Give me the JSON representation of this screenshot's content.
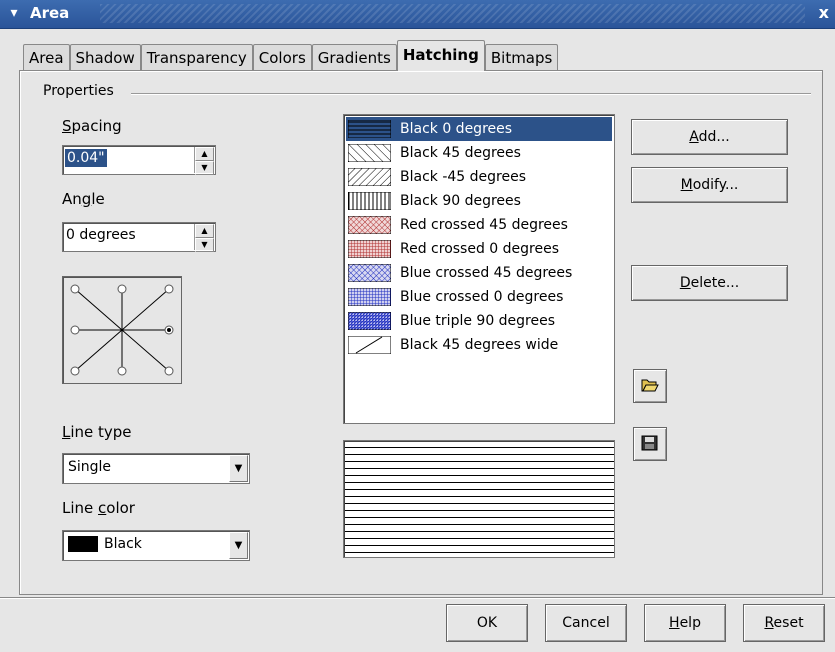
{
  "window": {
    "title": "Area",
    "close_glyph": "x"
  },
  "tabs": [
    {
      "label": "Area",
      "active": false
    },
    {
      "label": "Shadow",
      "active": false
    },
    {
      "label": "Transparency",
      "active": false
    },
    {
      "label": "Colors",
      "active": false
    },
    {
      "label": "Gradients",
      "active": false
    },
    {
      "label": "Hatching",
      "active": true
    },
    {
      "label": "Bitmaps",
      "active": false
    }
  ],
  "properties": {
    "group_label": "Properties",
    "spacing": {
      "label_u": "S",
      "label_rest": "pacing",
      "value": "0.04\""
    },
    "angle": {
      "label_pre": "An",
      "label_u": "g",
      "label_rest": "le",
      "value": "0 degrees"
    },
    "line_type": {
      "label_pre": "",
      "label_u": "L",
      "label_rest": "ine type",
      "value": "Single"
    },
    "line_color": {
      "label_pre": "Line ",
      "label_u": "c",
      "label_rest": "olor",
      "value": "Black",
      "swatch_color": "#000000"
    }
  },
  "hatch_list": [
    {
      "label": "Black 0 degrees",
      "selected": true
    },
    {
      "label": "Black 45 degrees",
      "selected": false
    },
    {
      "label": "Black -45 degrees",
      "selected": false
    },
    {
      "label": "Black 90 degrees",
      "selected": false
    },
    {
      "label": "Red crossed 45 degrees",
      "selected": false
    },
    {
      "label": "Red crossed 0 degrees",
      "selected": false
    },
    {
      "label": "Blue crossed 45 degrees",
      "selected": false
    },
    {
      "label": "Blue crossed 0 degrees",
      "selected": false
    },
    {
      "label": "Blue triple 90 degrees",
      "selected": false
    },
    {
      "label": "Black 45 degrees wide",
      "selected": false
    }
  ],
  "buttons": {
    "add": {
      "u": "A",
      "rest": "dd..."
    },
    "modify": {
      "u": "M",
      "rest": "odify..."
    },
    "delete": {
      "u": "D",
      "rest": "elete..."
    }
  },
  "icons": {
    "open": "folder-open-icon",
    "save": "save-disk-icon"
  },
  "footer": {
    "ok": "OK",
    "cancel": "Cancel",
    "help": {
      "u": "H",
      "rest": "elp"
    },
    "reset": {
      "u": "R",
      "rest": "eset"
    }
  },
  "colors": {
    "selection": "#2c5289",
    "red_hatch": "#b03030",
    "blue_hatch": "#2030c0"
  }
}
